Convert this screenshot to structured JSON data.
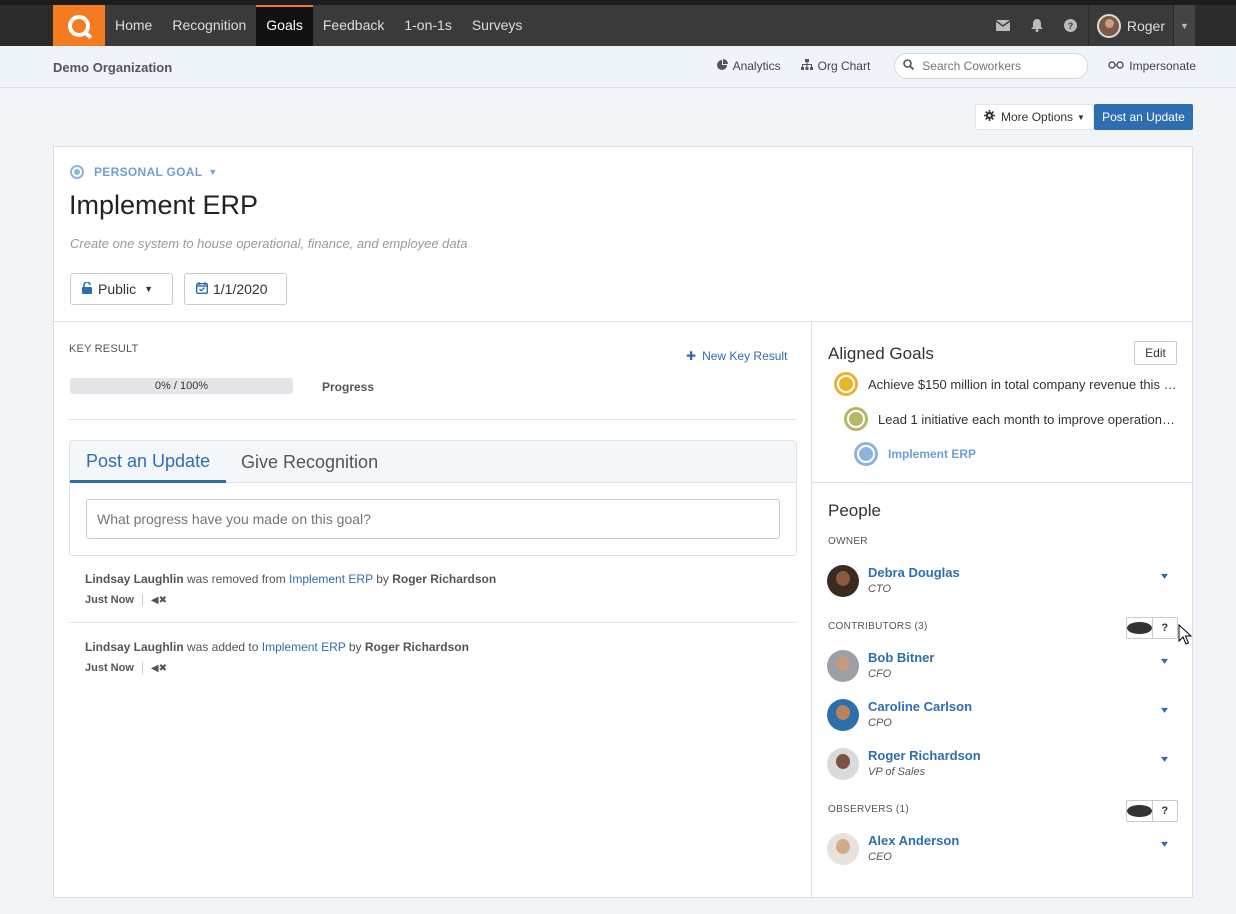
{
  "nav": {
    "links": [
      "Home",
      "Recognition",
      "Goals",
      "Feedback",
      "1-on-1s",
      "Surveys"
    ],
    "active": "Goals",
    "user_name": "Roger",
    "icons": [
      "envelope-icon",
      "bell-icon",
      "help-icon"
    ]
  },
  "subheader": {
    "org_name": "Demo Organization",
    "analytics_label": "Analytics",
    "org_chart_label": "Org Chart",
    "search_placeholder": "Search Coworkers",
    "impersonate_label": "Impersonate"
  },
  "actions": {
    "more_options_label": "More Options",
    "post_update_label": "Post an Update"
  },
  "goal": {
    "type_label": "PERSONAL GOAL",
    "title": "Implement ERP",
    "description": "Create one system to house operational, finance, and employee data",
    "visibility_label": "Public",
    "due_date": "1/1/2020"
  },
  "key_result": {
    "section_label": "KEY RESULT",
    "new_key_result_label": "New Key Result",
    "progress_text": "0% / 100%",
    "progress_fraction": 0,
    "progress_label": "Progress"
  },
  "composer": {
    "tab_post": "Post an Update",
    "tab_recognition": "Give Recognition",
    "placeholder": "What progress have you made on this goal?"
  },
  "feed": [
    {
      "subject": "Lindsay Laughlin",
      "verb": " was removed from ",
      "goal": "Implement ERP",
      "by": " by ",
      "actor": "Roger Richardson",
      "time": "Just Now"
    },
    {
      "subject": "Lindsay Laughlin",
      "verb": " was added to ",
      "goal": "Implement ERP",
      "by": " by ",
      "actor": "Roger Richardson",
      "time": "Just Now"
    }
  ],
  "aligned_goals": {
    "title": "Aligned Goals",
    "edit_label": "Edit",
    "items": [
      {
        "text": "Achieve $150 million in total company revenue this y...",
        "color": "#e8b62c"
      },
      {
        "text": "Lead 1 initiative each month to improve operationa...",
        "color": "#b8b86a"
      },
      {
        "text": "Implement ERP",
        "color": "#8fb3de"
      }
    ]
  },
  "people": {
    "title": "People",
    "owner_label": "OWNER",
    "owner": {
      "name": "Debra Douglas",
      "title": "CTO"
    },
    "contributors_label": "CONTRIBUTORS (3)",
    "contributors": [
      {
        "name": "Bob Bitner",
        "title": "CFO"
      },
      {
        "name": "Caroline Carlson",
        "title": "CPO"
      },
      {
        "name": "Roger Richardson",
        "title": "VP of Sales"
      }
    ],
    "observers_label": "OBSERVERS (1)",
    "observers": [
      {
        "name": "Alex Anderson",
        "title": "CEO"
      }
    ],
    "help_glyph": "?"
  },
  "colors": {
    "accent": "#2f6db2",
    "brand": "#f47b20",
    "goal_type": "#6f9fd6"
  }
}
